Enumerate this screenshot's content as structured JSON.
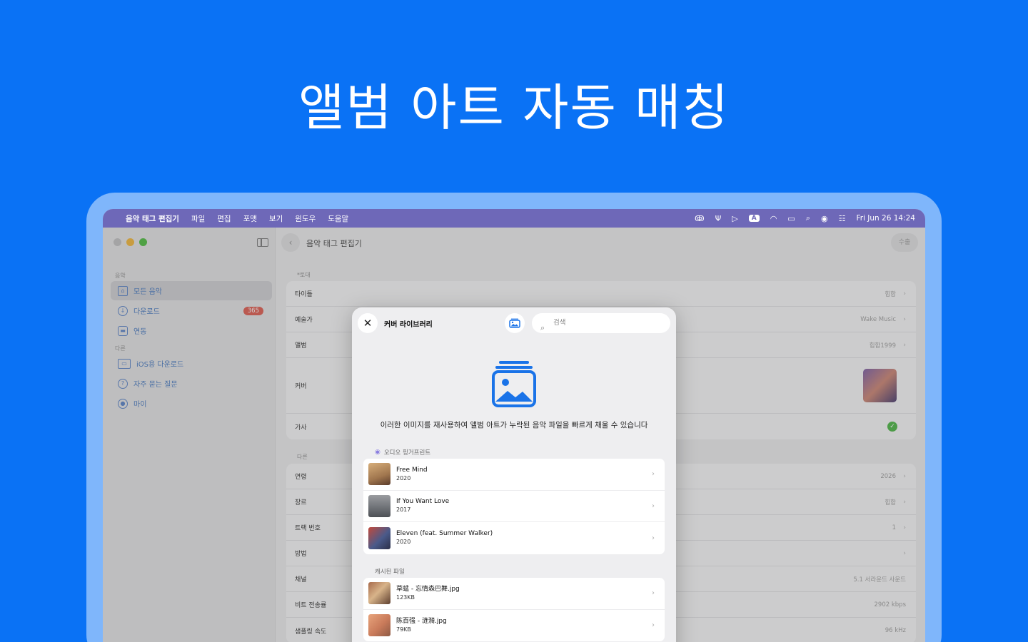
{
  "hero_title": "앨범 아트 자동 매칭",
  "menubar": {
    "app": "음악 태그 편집기",
    "menus": [
      "파일",
      "편집",
      "포맷",
      "보기",
      "윈도우",
      "도움말"
    ],
    "input_indicator": "A",
    "datetime": "Fri Jun 26  14:24"
  },
  "sidebar": {
    "section1": "음악",
    "items": [
      {
        "label": "모든 음악",
        "icon": "home-icon"
      },
      {
        "label": "다운로드",
        "icon": "download-icon",
        "badge": "365"
      },
      {
        "label": "연동",
        "icon": "car-icon"
      }
    ],
    "section2": "다른",
    "items2": [
      {
        "label": "iOS용 다운로드",
        "icon": "laptop-phone-icon"
      },
      {
        "label": "자주 묻는 질문",
        "icon": "question-icon"
      },
      {
        "label": "마이",
        "icon": "person-icon"
      }
    ]
  },
  "main": {
    "title": "음악 태그 편집기",
    "save": "수출",
    "group1": "*토대",
    "rows1": [
      {
        "label": "타이틀",
        "value": "힙합"
      },
      {
        "label": "예술가",
        "value": "Wake Music"
      },
      {
        "label": "앨범",
        "value": "힙합1999"
      },
      {
        "label": "커버",
        "value": ""
      },
      {
        "label": "가사",
        "value": ""
      }
    ],
    "group2": "다른",
    "rows2": [
      {
        "label": "연령",
        "value": "2026"
      },
      {
        "label": "장르",
        "value": "힙합"
      },
      {
        "label": "트랙 번호",
        "value": "1"
      },
      {
        "label": "방법",
        "value": ""
      },
      {
        "label": "채널",
        "value": "5.1 서라운드 사운드"
      },
      {
        "label": "비트 전송률",
        "value": "2902 kbps"
      },
      {
        "label": "샘플링 속도",
        "value": "96 kHz"
      }
    ]
  },
  "modal": {
    "title": "커버 라이브러리",
    "search_placeholder": "검색",
    "description": "이러한 이미지를 재사용하여 앨범 아트가 누락된 음악 파일을 빠르게 채울 수 있습니다",
    "section_fingerprint": "오디오 핑거프린트",
    "fingerprint_items": [
      {
        "title": "Free Mind",
        "sub": "2020"
      },
      {
        "title": "If You Want Love",
        "sub": "2017"
      },
      {
        "title": "Eleven (feat. Summer Walker)",
        "sub": "2020"
      }
    ],
    "section_cached": "캐시된 파일",
    "cached_items": [
      {
        "title": "草蜢 - 忘情森巴舞.jpg",
        "sub": "123KB"
      },
      {
        "title": "陈百强 - 涟漪.jpg",
        "sub": "79KB"
      }
    ]
  },
  "colors": {
    "background": "#0a72f5",
    "menubar": "#6e68b8",
    "accent": "#1a73e8",
    "badge": "#e36d62",
    "check": "#5fbf58"
  }
}
